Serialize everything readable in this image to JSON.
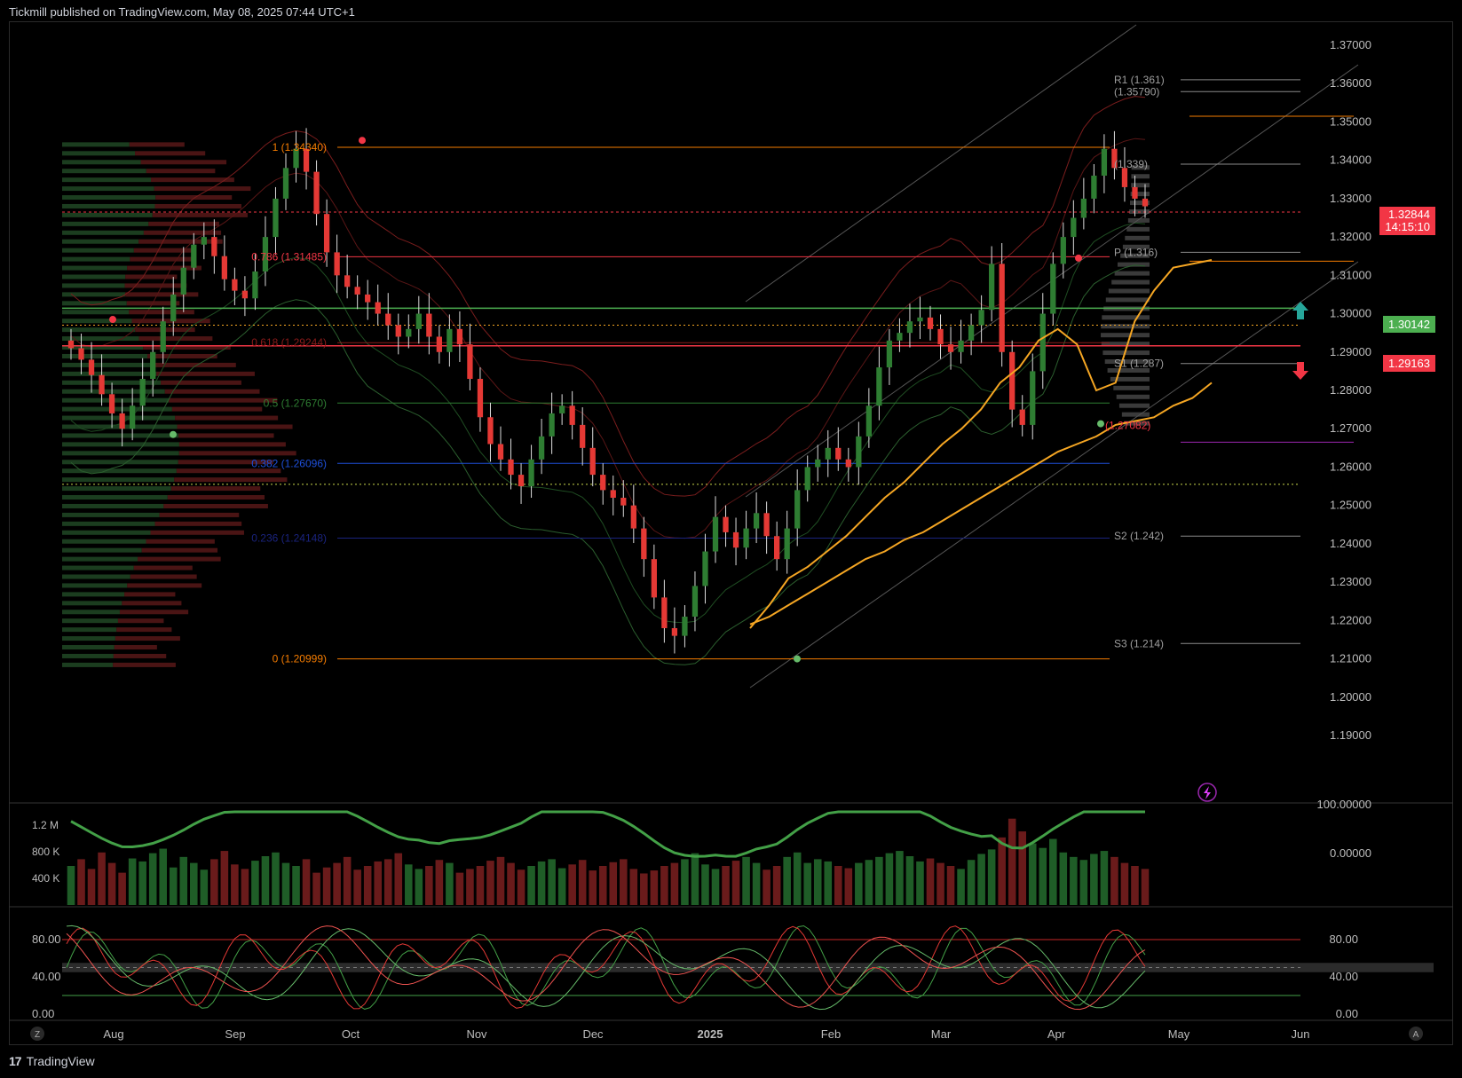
{
  "header": {
    "text": "Tickmill published on TradingView.com, May 08, 2025 07:44 UTC+1"
  },
  "footer": {
    "brand": "TradingView",
    "logo": "17",
    "left_button": "Z",
    "right_button": "A"
  },
  "colors": {
    "background": "#000000",
    "up": "#2e7d32",
    "down": "#e53935",
    "fib_orange": "#f57c00",
    "pivot_white": "#9e9e9e",
    "green_line": "#4caf50",
    "red_line": "#f23645",
    "ma_orange": "#f5a623",
    "blue_level": "#1e3a8a"
  },
  "chart_data": {
    "type": "candlestick",
    "price_axis": {
      "min": 1.185,
      "max": 1.375,
      "ticks": [
        "1.37000",
        "1.36000",
        "1.35000",
        "1.34000",
        "1.33000",
        "1.32000",
        "1.31000",
        "1.30000",
        "1.29000",
        "1.28000",
        "1.27000",
        "1.26000",
        "1.25000",
        "1.24000",
        "1.23000",
        "1.22000",
        "1.21000",
        "1.20000",
        "1.19000"
      ]
    },
    "time_axis": {
      "labels": [
        "Aug",
        "Sep",
        "Oct",
        "Nov",
        "Dec",
        "2025",
        "Feb",
        "Mar",
        "Apr",
        "May",
        "Jun"
      ]
    },
    "current_price": {
      "value": "1.32844",
      "countdown": "14:15:10"
    },
    "level_tags": [
      {
        "label": "1.30142",
        "color": "#4caf50",
        "value": 1.30142
      },
      {
        "label": "1.29163",
        "color": "#f23645",
        "value": 1.29163
      }
    ],
    "fib_levels": [
      {
        "label": "1 (1.34340)",
        "value": 1.3434,
        "color": "#f57c00"
      },
      {
        "label": "0.786 (1.31485)",
        "value": 1.31485,
        "color": "#f23645"
      },
      {
        "label": "0.618 (1.29244)",
        "value": 1.29244,
        "color": "#8b1a1a"
      },
      {
        "label": "0.5 (1.27670)",
        "value": 1.2767,
        "color": "#2e7d32"
      },
      {
        "label": "0.382 (1.26096)",
        "value": 1.26096,
        "color": "#1e4fd8"
      },
      {
        "label": "0.236 (1.24148)",
        "value": 1.24148,
        "color": "#1a237e"
      },
      {
        "label": "0 (1.20999)",
        "value": 1.20999,
        "color": "#f57c00"
      }
    ],
    "pivots": [
      {
        "label": "R1 (1.361)",
        "value": 1.361
      },
      {
        "label": "(1.35790)",
        "value": 1.3579
      },
      {
        "label": "(1.339)",
        "value": 1.339
      },
      {
        "label": "P (1.316)",
        "value": 1.316
      },
      {
        "label": "S1 (1.287)",
        "value": 1.287
      },
      {
        "label": "S2 (1.242)",
        "value": 1.242
      },
      {
        "label": "S3 (1.214)",
        "value": 1.214
      }
    ],
    "annotations": [
      {
        "label": "(1.27082)",
        "value": 1.27082
      }
    ],
    "closes": [
      1.291,
      1.288,
      1.284,
      1.279,
      1.274,
      1.27,
      1.276,
      1.283,
      1.29,
      1.298,
      1.305,
      1.312,
      1.318,
      1.32,
      1.315,
      1.309,
      1.306,
      1.304,
      1.311,
      1.32,
      1.33,
      1.338,
      1.343,
      1.337,
      1.326,
      1.316,
      1.31,
      1.307,
      1.305,
      1.303,
      1.3,
      1.297,
      1.294,
      1.296,
      1.3,
      1.294,
      1.29,
      1.296,
      1.292,
      1.283,
      1.273,
      1.266,
      1.262,
      1.258,
      1.255,
      1.262,
      1.268,
      1.274,
      1.276,
      1.271,
      1.265,
      1.258,
      1.254,
      1.252,
      1.25,
      1.244,
      1.236,
      1.226,
      1.218,
      1.216,
      1.221,
      1.229,
      1.238,
      1.247,
      1.243,
      1.239,
      1.244,
      1.248,
      1.242,
      1.236,
      1.244,
      1.254,
      1.26,
      1.262,
      1.265,
      1.262,
      1.26,
      1.268,
      1.276,
      1.286,
      1.293,
      1.295,
      1.298,
      1.299,
      1.296,
      1.292,
      1.29,
      1.293,
      1.297,
      1.301,
      1.313,
      1.29,
      1.275,
      1.271,
      1.285,
      1.3,
      1.313,
      1.32,
      1.325,
      1.33,
      1.336,
      1.343,
      1.338,
      1.333,
      1.33,
      1.328
    ],
    "ma_slow": [
      1.219,
      1.221,
      1.224,
      1.227,
      1.23,
      1.233,
      1.236,
      1.238,
      1.241,
      1.243,
      1.246,
      1.249,
      1.252,
      1.255,
      1.258,
      1.261,
      1.264,
      1.266,
      1.268,
      1.271,
      1.272,
      1.273,
      1.276,
      1.278,
      1.282
    ],
    "ma_fast": [
      1.218,
      1.224,
      1.231,
      1.234,
      1.238,
      1.242,
      1.247,
      1.252,
      1.256,
      1.261,
      1.266,
      1.27,
      1.275,
      1.282,
      1.286,
      1.293,
      1.296,
      1.292,
      1.28,
      1.282,
      1.298,
      1.306,
      1.312,
      1.313,
      1.314
    ],
    "volume_axis": {
      "ticks": [
        "1.2 M",
        "800 K",
        "400 K"
      ],
      "right_ticks": [
        "100.00000",
        "0.00000"
      ]
    },
    "volume": [
      520,
      610,
      480,
      700,
      560,
      430,
      620,
      580,
      690,
      750,
      500,
      640,
      560,
      470,
      610,
      720,
      540,
      480,
      590,
      650,
      700,
      560,
      520,
      610,
      430,
      500,
      560,
      640,
      470,
      520,
      580,
      610,
      690,
      540,
      480,
      520,
      600,
      560,
      430,
      480,
      520,
      590,
      640,
      560,
      470,
      520,
      580,
      610,
      490,
      540,
      600,
      460,
      520,
      570,
      610,
      480,
      420,
      460,
      520,
      560,
      610,
      690,
      540,
      480,
      520,
      590,
      640,
      560,
      470,
      520,
      640,
      700,
      560,
      610,
      580,
      520,
      490,
      560,
      600,
      640,
      690,
      720,
      650,
      580,
      620,
      560,
      520,
      480,
      600,
      680,
      740,
      900,
      1150,
      980,
      820,
      760,
      880,
      700,
      640,
      600,
      680,
      720,
      640,
      560,
      520,
      480
    ],
    "oscillator_axis": {
      "ticks": [
        "80.00",
        "40.00",
        "0.00"
      ],
      "levels": [
        80,
        50,
        40,
        20
      ]
    }
  }
}
